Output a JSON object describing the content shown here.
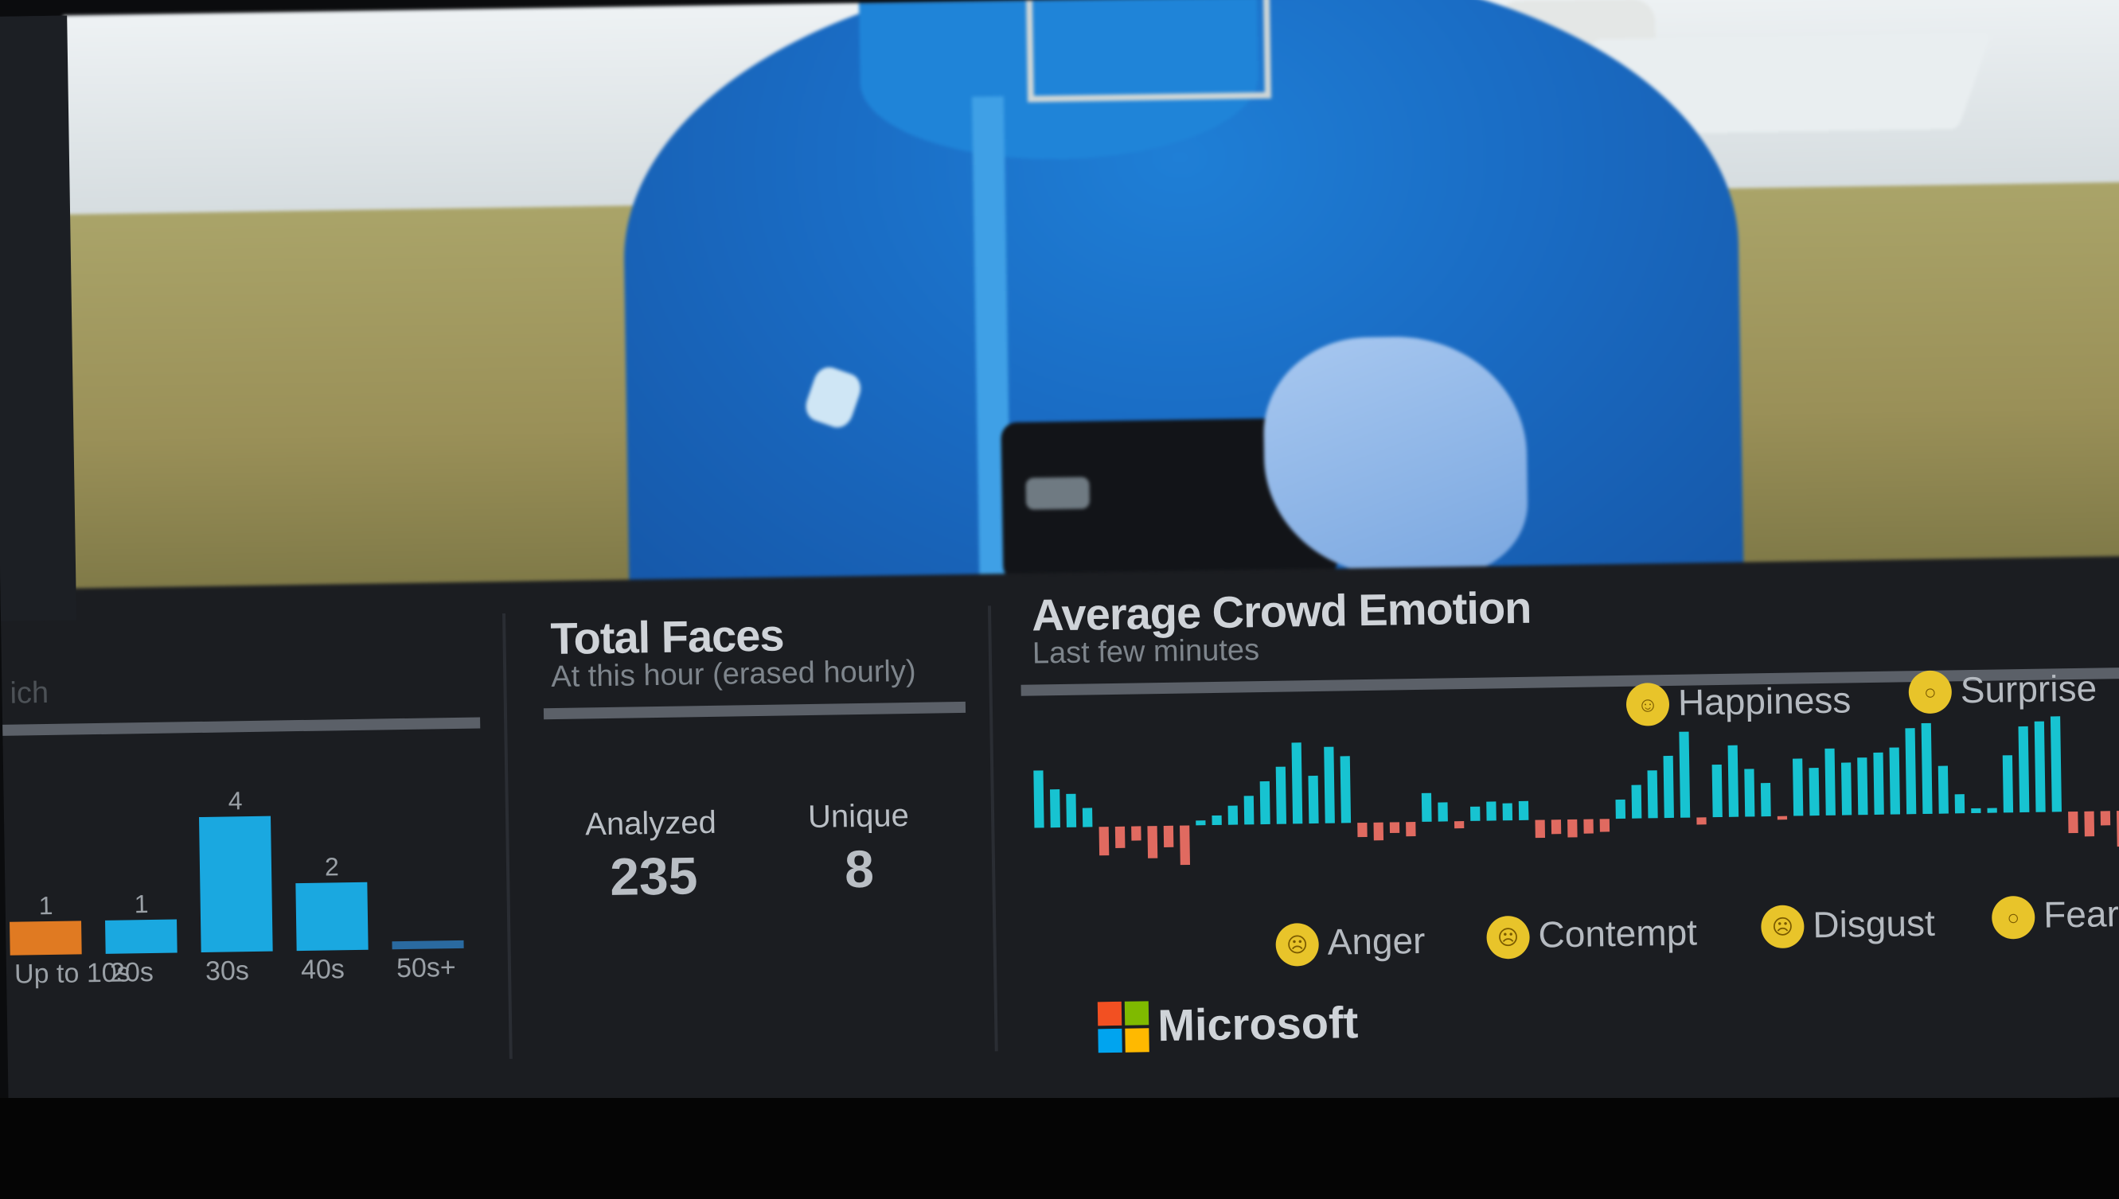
{
  "age_panel": {
    "title_fragment": "ich",
    "bars": [
      {
        "label": "Up to 10s",
        "count": "1",
        "value": 1,
        "color": "#e07a22"
      },
      {
        "label": "20s",
        "count": "1",
        "value": 1,
        "color": "#1aa8e0"
      },
      {
        "label": "30s",
        "count": "4",
        "value": 4,
        "color": "#1aa8e0"
      },
      {
        "label": "40s",
        "count": "2",
        "value": 2,
        "color": "#1aa8e0"
      },
      {
        "label": "50s+",
        "count": "",
        "value": 0,
        "color": "#2a6aa0"
      }
    ]
  },
  "faces_panel": {
    "title": "Total Faces",
    "subtitle": "At this hour (erased hourly)",
    "analyzed_label": "Analyzed",
    "analyzed_value": "235",
    "unique_label": "Unique",
    "unique_value": "8"
  },
  "emotion_panel": {
    "title": "Average Crowd Emotion",
    "subtitle": "Last few minutes",
    "legend_top": [
      {
        "name": "Happiness",
        "icon": "happy-face-icon"
      },
      {
        "name": "Surprise",
        "icon": "surprise-face-icon"
      }
    ],
    "legend_bottom": [
      {
        "name": "Anger",
        "icon": "anger-face-icon"
      },
      {
        "name": "Contempt",
        "icon": "contempt-face-icon"
      },
      {
        "name": "Disgust",
        "icon": "disgust-face-icon"
      },
      {
        "name": "Fear",
        "icon": "fear-face-icon"
      }
    ],
    "positive_color": "#17c3d1",
    "negative_color": "#e06a60",
    "series": [
      0.6,
      0.4,
      0.35,
      0.2,
      -0.4,
      -0.3,
      -0.2,
      -0.45,
      -0.3,
      -0.55,
      0.05,
      0.1,
      0.2,
      0.3,
      0.45,
      0.6,
      0.85,
      0.5,
      0.8,
      0.7,
      -0.2,
      -0.25,
      -0.15,
      -0.2,
      0.3,
      0.2,
      -0.1,
      0.15,
      0.2,
      0.18,
      0.2,
      -0.25,
      -0.2,
      -0.25,
      -0.2,
      -0.18,
      0.2,
      0.35,
      0.5,
      0.65,
      0.9,
      -0.1,
      0.55,
      0.75,
      0.5,
      0.35,
      -0.05,
      0.6,
      0.5,
      0.7,
      0.55,
      0.6,
      0.65,
      0.7,
      0.9,
      0.95,
      0.5,
      0.2,
      0.05,
      0.05,
      0.6,
      0.9,
      0.95,
      1.0,
      -0.3,
      -0.35,
      -0.2,
      -0.5
    ]
  },
  "brand": {
    "name": "Microsoft",
    "logo_colors": [
      "#f25022",
      "#7fba00",
      "#00a4ef",
      "#ffb900"
    ]
  }
}
